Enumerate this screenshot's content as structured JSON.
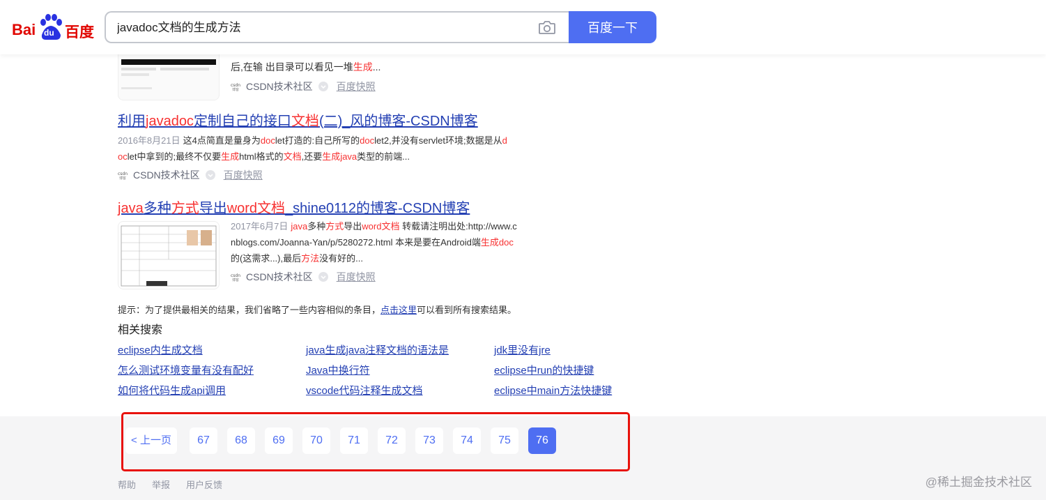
{
  "logo": {
    "bai": "Bai",
    "du": "du",
    "baidu": "百度"
  },
  "search": {
    "query": "javadoc文档的生成方法",
    "button_label": "百度一下"
  },
  "result0": {
    "abstract_tail_prefix": "后,在输 出目录可以看见一堆",
    "abstract_tail_em": "生成",
    "abstract_tail_suffix": "...",
    "source": "CSDN技术社区",
    "snapshot": "百度快照"
  },
  "result1": {
    "title_parts": [
      "利用",
      "javadoc",
      "定制自己的接口",
      "文档",
      "(二)_风的博客-CSDN博客"
    ],
    "date": "2016年8月21日",
    "abstract_line1_a": "这4点简直是量身为",
    "abstract_line1_em1": "doc",
    "abstract_line1_b": "let打造的:自己所写的",
    "abstract_line1_em2": "doc",
    "abstract_line1_c": "let2,并没有servlet环境;数据是从",
    "abstract_line1_em3": "d",
    "abstract_line2_em0": "oc",
    "abstract_line2_a": "let中拿到的;最终不仅要",
    "abstract_line2_em1": "生成",
    "abstract_line2_b": "html格式的",
    "abstract_line2_em2": "文档",
    "abstract_line2_c": ",还要",
    "abstract_line2_em3": "生成",
    "abstract_line2_em4": "java",
    "abstract_line2_d": "类型的前端...",
    "source": "CSDN技术社区",
    "snapshot": "百度快照"
  },
  "result2": {
    "title_parts": [
      "java",
      "多种",
      "方式",
      "导出",
      "word",
      "文档",
      "_shine0112的博客-CSDN博客"
    ],
    "date": "2017年6月7日",
    "abs1_em1": "java",
    "abs1_a": "多种",
    "abs1_em2": "方式",
    "abs1_b": "导出",
    "abs1_em3": "word",
    "abs1_em4": "文档",
    "abs1_c": " 转载请注明出处:http://www.c",
    "abs2_a": "nblogs.com/Joanna-Yan/p/5280272.html 本来是要在Android端",
    "abs2_em1": "生成",
    "abs2_em2": "doc",
    "abs3_a": "的(这需求...),最后",
    "abs3_em1": "方法",
    "abs3_b": "没有好的...",
    "source": "CSDN技术社区",
    "snapshot": "百度快照"
  },
  "tip": {
    "prefix": "提示：为了提供最相关的结果，我们省略了一些内容相似的条目，",
    "link": "点击这里",
    "suffix": "可以看到所有搜索结果。"
  },
  "related": {
    "title": "相关搜索",
    "items": [
      "eclipse内生成文档",
      "java生成java注释文档的语法是",
      "jdk里没有jre",
      "怎么测试环境变量有没有配好",
      "Java中换行符",
      "eclipse中run的快捷键",
      "如何将代码生成api调用",
      "vscode代码注释生成文档",
      "eclipse中main方法快捷键"
    ]
  },
  "pager": {
    "prev": "< 上一页",
    "pages": [
      "67",
      "68",
      "69",
      "70",
      "71",
      "72",
      "73",
      "74",
      "75",
      "76"
    ],
    "current": "76"
  },
  "footer": {
    "help": "帮助",
    "report": "举报",
    "feedback": "用户反馈"
  },
  "watermark": "@稀土掘金技术社区",
  "colors": {
    "brand_blue": "#4e6ef2",
    "logo_red": "#e10601",
    "highlight": "#f73131",
    "link": "#2440b3"
  }
}
